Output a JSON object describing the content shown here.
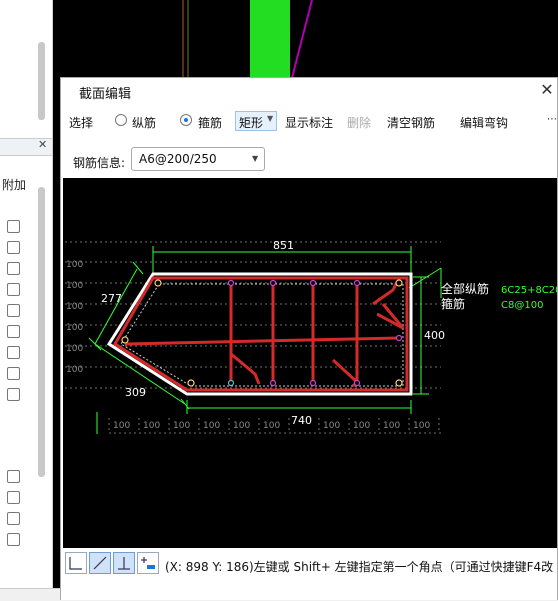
{
  "left_panel": {
    "column_label": "附加",
    "close": "✕"
  },
  "dialog": {
    "title": "截面编辑",
    "close": "✕",
    "toolbar": {
      "select": "选择",
      "longitudinal": "纵筋",
      "stirrup": "箍筋",
      "rect": "矩形",
      "show_annot": "显示标注",
      "delete": "删除",
      "clear": "清空钢筋",
      "edit_hook": "编辑弯钩",
      "more": "⋯"
    },
    "info_label": "钢筋信息:",
    "info_value": "A6@200/250",
    "canvas": {
      "annot_all_long": "全部纵筋",
      "annot_all_long_val": "6C25+8C20",
      "annot_stirrup": "箍筋",
      "annot_stirrup_val": "C8@100",
      "dim_top": "851",
      "dim_left_upper": "277",
      "dim_left_lower": "309",
      "dim_bottom": "740",
      "dim_right": "400",
      "grid_label": "100",
      "colors": {
        "outline": "#ffffff",
        "rebar": "#d42a2a",
        "dim": "#33ff33",
        "annot": "#ffffff",
        "annot_val": "#33ff33"
      }
    },
    "status": "(X: 898 Y: 186)左键或 Shift+ 左键指定第一个角点（可通过快捷键F4改"
  }
}
